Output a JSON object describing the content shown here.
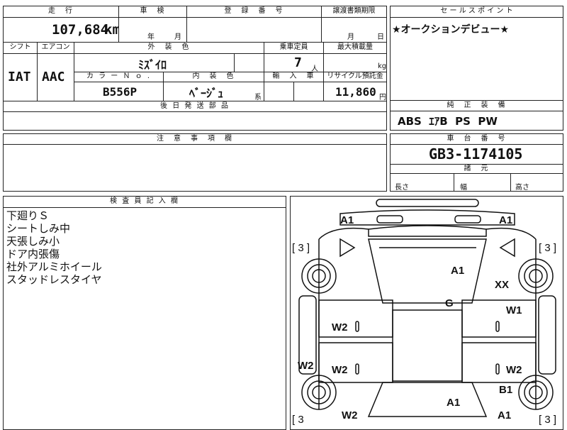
{
  "top": {
    "mileage_label": "走　行",
    "mileage_value": "107,684",
    "mileage_unit": "km",
    "inspection_label": "車　検",
    "inspection_year": "年",
    "inspection_month": "月",
    "registration_label": "登　録　番　号",
    "transfer_label": "譲渡書類期限",
    "transfer_month": "月",
    "transfer_day": "日",
    "salespoint_label": "セ ー ル ス ポ イ ン ト",
    "salespoint_text": "★オークションデビュー★"
  },
  "mid": {
    "shift_label": "シフト",
    "aircon_label": "エアコン",
    "color_label": "外　装　色",
    "capacity_label": "乗車定員",
    "load_label": "最大積載量",
    "shift_value": "IAT",
    "aircon_value": "AAC",
    "color_value": "ﾐｽﾞｲﾛ",
    "capacity_value": "7",
    "capacity_unit": "人",
    "load_unit": "kg",
    "colorno_label": "カ ラ ー Ｎ ｏ .",
    "interior_label": "内　装　色",
    "import_label": "輸　入　車",
    "recycle_label": "リサイクル預託金",
    "colorno_value": "B556P",
    "interior_value": "ﾍﾞｰｼﾞｭ",
    "interior_suffix": "系",
    "recycle_value": "11,860",
    "recycle_unit": "円",
    "later_parts_label": "後 日 発 送 部 品",
    "genuine_label": "純　正　装　備",
    "genuine_value": "ABS  ｴｱB  PS  PW"
  },
  "notes_box": {
    "caution_label": "注　意　事　項　欄",
    "chassis_label": "車　台　番　号",
    "chassis_value": "GB3-1174105",
    "dims_label": "諸　元",
    "length_label": "長さ",
    "width_label": "幅",
    "height_label": "高さ"
  },
  "inspector": {
    "label": "検 査 員 記 入 欄",
    "lines": [
      "下廻りＳ",
      "シートしみ中",
      "天張しみ小",
      "ドア内張傷",
      "社外アルミホイール",
      "スタッドレスタイヤ"
    ]
  },
  "diagram": {
    "marks": {
      "a1_tl": "A1",
      "a1_tr": "A1",
      "a1_hood": "A1",
      "xx": "XX",
      "g": "G",
      "w1": "W1",
      "w2_l1": "W2",
      "w2_l2": "W2",
      "w2_side": "W2",
      "w2_r": "W2",
      "b1": "B1",
      "a1_rear": "A1",
      "a1_br": "A1",
      "w2_bl": "W2"
    },
    "tire_tl": "[ 3 ]",
    "tire_tr": "[ 3 ]",
    "tire_bl": "[ 3",
    "tire_br": "[ 3 ]"
  }
}
